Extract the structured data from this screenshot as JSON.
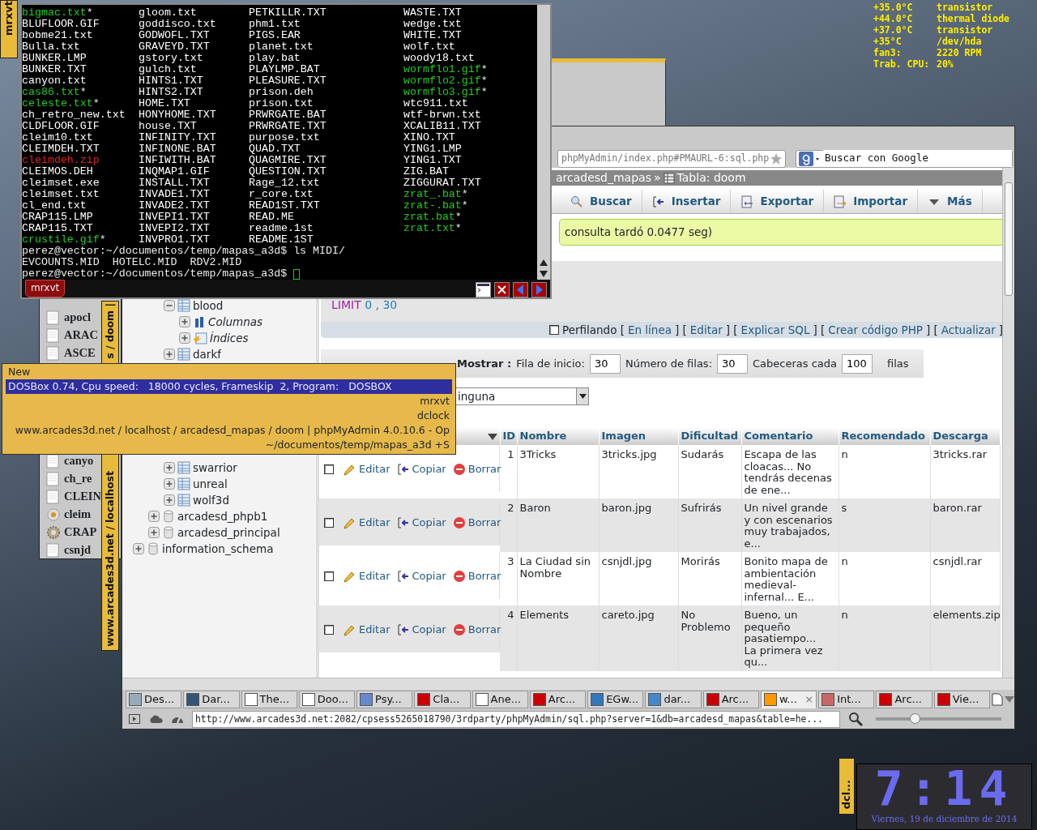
{
  "sensors": [
    {
      "reading": "+35.0°C",
      "label": "transistor"
    },
    {
      "reading": "+44.0°C",
      "label": "thermal diode"
    },
    {
      "reading": "+37.0°C",
      "label": "transistor"
    },
    {
      "reading": "+35°C",
      "label": "/dev/hda"
    },
    {
      "reading": "fan3:",
      "label": "2220 RPM"
    },
    {
      "reading": "Trab. CPU:",
      "label": "20%"
    }
  ],
  "terminal": {
    "side_tab": "mrxvt",
    "tab": "mrxvt",
    "files": [
      {
        "name": "bigmac.txt",
        "color": "#22cc22",
        "suffix": "*"
      },
      {
        "name": "BLUFLOOR.GIF",
        "color": "#ffffff"
      },
      {
        "name": "bobme21.txt",
        "color": "#ffffff"
      },
      {
        "name": "Bulla.txt",
        "color": "#ffffff"
      },
      {
        "name": "BUNKER.LMP",
        "color": "#ffffff"
      },
      {
        "name": "BUNKER.TXT",
        "color": "#ffffff"
      },
      {
        "name": "canyon.txt",
        "color": "#ffffff"
      },
      {
        "name": "cas86.txt",
        "color": "#22cc22",
        "suffix": "*"
      },
      {
        "name": "celeste.txt",
        "color": "#22cc22",
        "suffix": "*"
      },
      {
        "name": "ch_retro_new.txt",
        "color": "#ffffff"
      },
      {
        "name": "CLDFLOOR.GIF",
        "color": "#ffffff"
      },
      {
        "name": "cleim10.txt",
        "color": "#ffffff"
      },
      {
        "name": "CLEIMDEH.TXT",
        "color": "#ffffff"
      },
      {
        "name": "cleimdeh.zip",
        "color": "#dd2222"
      },
      {
        "name": "CLEIMOS.DEH",
        "color": "#ffffff"
      },
      {
        "name": "cleimset.exe",
        "color": "#ffffff"
      },
      {
        "name": "cleimset.txt",
        "color": "#ffffff"
      },
      {
        "name": "cl_end.txt",
        "color": "#ffffff"
      },
      {
        "name": "CRAP115.LMP",
        "color": "#ffffff"
      },
      {
        "name": "CRAP115.TXT",
        "color": "#ffffff"
      },
      {
        "name": "crustile.gif",
        "color": "#22cc22",
        "suffix": "*"
      },
      {
        "name": "gloom.txt",
        "color": "#ffffff"
      },
      {
        "name": "goddisco.txt",
        "color": "#ffffff"
      },
      {
        "name": "GODWOFL.TXT",
        "color": "#ffffff"
      },
      {
        "name": "GRAVEYD.TXT",
        "color": "#ffffff"
      },
      {
        "name": "gstory.txt",
        "color": "#ffffff"
      },
      {
        "name": "gulch.txt",
        "color": "#ffffff"
      },
      {
        "name": "HINTS1.TXT",
        "color": "#ffffff"
      },
      {
        "name": "HINTS2.TXT",
        "color": "#ffffff"
      },
      {
        "name": "HOME.TXT",
        "color": "#ffffff"
      },
      {
        "name": "HONYHOME.TXT",
        "color": "#ffffff"
      },
      {
        "name": "house.TXT",
        "color": "#ffffff"
      },
      {
        "name": "INFINITY.TXT",
        "color": "#ffffff"
      },
      {
        "name": "INFINONE.BAT",
        "color": "#ffffff"
      },
      {
        "name": "INFIWITH.BAT",
        "color": "#ffffff"
      },
      {
        "name": "INQMAP1.GIF",
        "color": "#ffffff"
      },
      {
        "name": "INSTALL.TXT",
        "color": "#ffffff"
      },
      {
        "name": "INVADE1.TXT",
        "color": "#ffffff"
      },
      {
        "name": "INVADE2.TXT",
        "color": "#ffffff"
      },
      {
        "name": "INVEPI1.TXT",
        "color": "#ffffff"
      },
      {
        "name": "INVEPI2.TXT",
        "color": "#ffffff"
      },
      {
        "name": "INVPRO1.TXT",
        "color": "#ffffff"
      },
      {
        "name": "PETKILLR.TXT",
        "color": "#ffffff"
      },
      {
        "name": "phm1.txt",
        "color": "#ffffff"
      },
      {
        "name": "PIGS.EAR",
        "color": "#ffffff"
      },
      {
        "name": "planet.txt",
        "color": "#ffffff"
      },
      {
        "name": "play.bat",
        "color": "#ffffff"
      },
      {
        "name": "PLAYLMP.BAT",
        "color": "#ffffff"
      },
      {
        "name": "PLEASURE.TXT",
        "color": "#ffffff"
      },
      {
        "name": "prison.deh",
        "color": "#ffffff"
      },
      {
        "name": "prison.txt",
        "color": "#ffffff"
      },
      {
        "name": "PRWRGATE.BAT",
        "color": "#ffffff"
      },
      {
        "name": "PRWRGATE.TXT",
        "color": "#ffffff"
      },
      {
        "name": "purpose.txt",
        "color": "#ffffff"
      },
      {
        "name": "QUAD.TXT",
        "color": "#ffffff"
      },
      {
        "name": "QUAGMIRE.TXT",
        "color": "#ffffff"
      },
      {
        "name": "QUESTION.TXT",
        "color": "#ffffff"
      },
      {
        "name": "Rage_12.txt",
        "color": "#ffffff"
      },
      {
        "name": "r_core.txt",
        "color": "#ffffff"
      },
      {
        "name": "READ1ST.TXT",
        "color": "#ffffff"
      },
      {
        "name": "READ.ME",
        "color": "#ffffff"
      },
      {
        "name": "readme.1st",
        "color": "#ffffff"
      },
      {
        "name": "README.1ST",
        "color": "#ffffff"
      },
      {
        "name": "WASTE.TXT",
        "color": "#ffffff"
      },
      {
        "name": "wedge.txt",
        "color": "#ffffff"
      },
      {
        "name": "WHITE.TXT",
        "color": "#ffffff"
      },
      {
        "name": "wolf.txt",
        "color": "#ffffff"
      },
      {
        "name": "woody18.txt",
        "color": "#ffffff"
      },
      {
        "name": "wormflo1.gif",
        "color": "#22cc22",
        "suffix": "*"
      },
      {
        "name": "wormflo2.gif",
        "color": "#22cc22",
        "suffix": "*"
      },
      {
        "name": "wormflo3.gif",
        "color": "#22cc22",
        "suffix": "*"
      },
      {
        "name": "wtc911.txt",
        "color": "#ffffff"
      },
      {
        "name": "wtf-brwn.txt",
        "color": "#ffffff"
      },
      {
        "name": "XCALIB11.TXT",
        "color": "#ffffff"
      },
      {
        "name": "XINO.TXT",
        "color": "#ffffff"
      },
      {
        "name": "YING1.LMP",
        "color": "#ffffff"
      },
      {
        "name": "YING1.TXT",
        "color": "#ffffff"
      },
      {
        "name": "ZIG.BAT",
        "color": "#ffffff"
      },
      {
        "name": "ZIGGURAT.TXT",
        "color": "#ffffff"
      },
      {
        "name": "zrat_.bat",
        "color": "#22cc22",
        "suffix": "*"
      },
      {
        "name": "zrat-.bat",
        "color": "#22cc22",
        "suffix": "*"
      },
      {
        "name": "zrat.bat",
        "color": "#22cc22",
        "suffix": "*"
      },
      {
        "name": "zrat.txt",
        "color": "#22cc22",
        "suffix": "*"
      }
    ],
    "lines": [
      "perez@vector:~/documentos/temp/mapas_a3d$ ls MIDI/",
      "EVCOUNTS.MID  HOTELC.MID  RDV2.MID"
    ],
    "prompt": "perez@vector:~/documentos/temp/mapas_a3d$"
  },
  "file_manager": {
    "title_parts": [
      "s / doom |",
      "www.arcades3d.net / localhost"
    ],
    "items": [
      {
        "name": "apocl",
        "kind": "file"
      },
      {
        "name": "ARAC",
        "kind": "file"
      },
      {
        "name": "ASCE",
        "kind": "file"
      },
      {
        "name": "canyo",
        "kind": "file"
      },
      {
        "name": "ch_re",
        "kind": "file"
      },
      {
        "name": "CLEIN",
        "kind": "file"
      },
      {
        "name": "cleim",
        "kind": "program"
      },
      {
        "name": "CRAP",
        "kind": "gear"
      },
      {
        "name": "csnjd",
        "kind": "file"
      }
    ]
  },
  "browser": {
    "address": "phpMyAdmin/index.php#PMAURL-6:sql.php",
    "search": {
      "placeholder": "Buscar con Google"
    },
    "breadcrumb": [
      "arcadesd_mapas",
      "»",
      "Tabla: doom"
    ],
    "tree": [
      {
        "children": [
          {
            "children": [
              {
                "label": "blood",
                "kind": "table",
                "expanded": true,
                "children": [
                  {
                    "label": "Columnas",
                    "kind": "columns",
                    "expanded": false
                  },
                  {
                    "label": "Índices",
                    "kind": "indexes",
                    "expanded": false
                  }
                ]
              },
              {
                "label": "darkf",
                "kind": "table",
                "expanded": false
              },
              {
                "label": "swarrior",
                "kind": "table",
                "expanded": false
              },
              {
                "label": "unreal",
                "kind": "table",
                "expanded": false
              },
              {
                "label": "wolf3d",
                "kind": "table",
                "expanded": false
              }
            ]
          },
          {
            "label": "arcadesd_phpb1",
            "kind": "db",
            "expanded": false
          },
          {
            "label": "arcadesd_principal",
            "kind": "db",
            "expanded": false
          }
        ]
      },
      {
        "label": "information_schema",
        "kind": "db",
        "expanded": false
      }
    ],
    "tabs": [
      {
        "label": "Buscar",
        "kind": "search"
      },
      {
        "label": "Insertar",
        "kind": "insert"
      },
      {
        "label": "Exportar",
        "kind": "export"
      },
      {
        "label": "Importar",
        "kind": "import"
      },
      {
        "label": "Más",
        "kind": "more"
      }
    ],
    "message": "consulta tardó 0.0477 seg)",
    "query": {
      "keyword": "LIMIT",
      "args": "0 , 30"
    },
    "profiling": {
      "checked": false,
      "parts": [
        {
          "kind": "text",
          "text": "Perfilando ["
        },
        {
          "kind": "link",
          "text": "En línea"
        },
        {
          "kind": "text",
          "text": "] ["
        },
        {
          "kind": "link",
          "text": "Editar"
        },
        {
          "kind": "text",
          "text": "] ["
        },
        {
          "kind": "link",
          "text": "Explicar SQL"
        },
        {
          "kind": "text",
          "text": "] ["
        },
        {
          "kind": "link",
          "text": "Crear código PHP"
        },
        {
          "kind": "text",
          "text": "] ["
        },
        {
          "kind": "link",
          "text": "Actualizar"
        },
        {
          "kind": "text",
          "text": "]"
        }
      ]
    },
    "navigation": {
      "label": "Mostrar :",
      "fields": [
        {
          "label": "Fila de inicio:",
          "value": "30"
        },
        {
          "label": "Número de filas:",
          "value": "30"
        },
        {
          "label": "Cabeceras cada",
          "value": "100"
        }
      ],
      "suffix": "filas"
    },
    "select": {
      "value": "inguna"
    },
    "table": {
      "columns": [
        "ID",
        "Nombre",
        "Imagen",
        "Dificultad",
        "Comentario",
        "Recomendado",
        "Descarga"
      ],
      "rows": [
        {
          "checked": false,
          "actions": [
            "Editar",
            "Copiar",
            "Borrar"
          ],
          "cells": [
            "1",
            "3Tricks",
            "3tricks.jpg",
            "Sudarás",
            "Escapa de las cloacas... No tendrás decenas de ene...",
            "n",
            "3tricks.rar"
          ]
        },
        {
          "checked": false,
          "actions": [
            "Editar",
            "Copiar",
            "Borrar"
          ],
          "cells": [
            "2",
            "Baron",
            "baron.jpg",
            "Sufrirás",
            "Un nivel grande y con escenarios muy trabajados, e...",
            "s",
            "baron.rar"
          ]
        },
        {
          "checked": false,
          "actions": [
            "Editar",
            "Copiar",
            "Borrar"
          ],
          "cells": [
            "3",
            "La Ciudad sin Nombre",
            "csnjdl.jpg",
            "Morirás",
            "Bonito mapa de ambientación medieval-infernal... E...",
            "n",
            "csnjdl.rar"
          ]
        },
        {
          "checked": false,
          "actions": [
            "Editar",
            "Copiar",
            "Borrar"
          ],
          "cells": [
            "4",
            "Elements",
            "careto.jpg",
            "No Problemo",
            "Bueno, un pequeño pasatiempo...\nLa primera vez qu...",
            "n",
            "elements.zip"
          ]
        }
      ]
    },
    "page_tabs": [
      {
        "label": "Des...",
        "kind": "disk",
        "selected": false
      },
      {
        "label": "Dar...",
        "kind": "photo",
        "selected": false
      },
      {
        "label": "The...",
        "kind": "go",
        "selected": false
      },
      {
        "label": "Doo...",
        "kind": "page",
        "selected": false
      },
      {
        "label": "Psy...",
        "kind": "psy",
        "selected": false
      },
      {
        "label": "Cla...",
        "kind": "arcade",
        "selected": false
      },
      {
        "label": "Ane...",
        "kind": "wiki",
        "selected": false
      },
      {
        "label": "Arc...",
        "kind": "arcade",
        "selected": false
      },
      {
        "label": "EGw...",
        "kind": "egw",
        "selected": false
      },
      {
        "label": "dar...",
        "kind": "google",
        "selected": false
      },
      {
        "label": "Arc...",
        "kind": "arcade",
        "selected": false
      },
      {
        "label": "w...",
        "kind": "cpanel",
        "selected": true,
        "close": "×"
      },
      {
        "label": "Int...",
        "kind": "globe",
        "selected": false
      },
      {
        "label": "Arc...",
        "kind": "arcade",
        "selected": false
      },
      {
        "label": "Vie...",
        "kind": "arcade",
        "selected": false
      }
    ],
    "status_url": "http://www.arcades3d.net:2082/cpsess5265018790/3rdparty/phpMyAdmin/sql.php?server=1&db=arcadesd_mapas&table=he...",
    "zoom": {
      "level": 0.31
    }
  },
  "popup_menu": [
    {
      "text": "New",
      "kind": "header",
      "selected": false
    },
    {
      "text": "DOSBox 0.74, Cpu speed:   18000 cycles, Frameskip  2, Program:   DOSBOX",
      "kind": "entry",
      "selected": true
    },
    {
      "text": "mrxvt",
      "kind": "entry",
      "selected": false
    },
    {
      "text": "dclock",
      "kind": "entry",
      "selected": false
    },
    {
      "text": "www.arcades3d.net / localhost / arcadesd_mapas / doom | phpMyAdmin 4.0.10.6 - Op",
      "kind": "entry",
      "selected": false
    },
    {
      "text": "~/documentos/temp/mapas_a3d +S",
      "kind": "entry",
      "selected": false
    }
  ],
  "clock": {
    "side_tab": "dcl...",
    "time": "7:14",
    "date": "Viernes, 19 de diciembre de 2014"
  }
}
